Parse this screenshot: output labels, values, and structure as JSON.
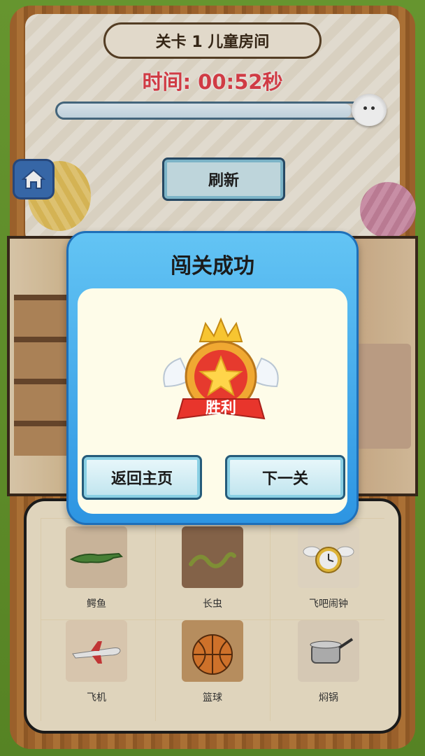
{
  "header": {
    "level_title": "关卡 1 儿童房间",
    "timer": "时间: 00:52秒",
    "progress_fraction": 0.97,
    "refresh_label": "刷新"
  },
  "items": [
    {
      "label": "鳄鱼",
      "icon": "crocodile-icon"
    },
    {
      "label": "长虫",
      "icon": "snake-icon"
    },
    {
      "label": "飞吧闹钟",
      "icon": "winged-clock-icon"
    },
    {
      "label": "飞机",
      "icon": "airplane-icon"
    },
    {
      "label": "篮球",
      "icon": "basketball-icon"
    },
    {
      "label": "焖锅",
      "icon": "pot-icon"
    }
  ],
  "modal": {
    "title": "闯关成功",
    "badge_text": "胜利",
    "home_label": "返回主页",
    "next_label": "下一关"
  },
  "colors": {
    "timer": "#e2404a",
    "modal_blue": "#2d95e2",
    "badge_red": "#e63a2e"
  }
}
